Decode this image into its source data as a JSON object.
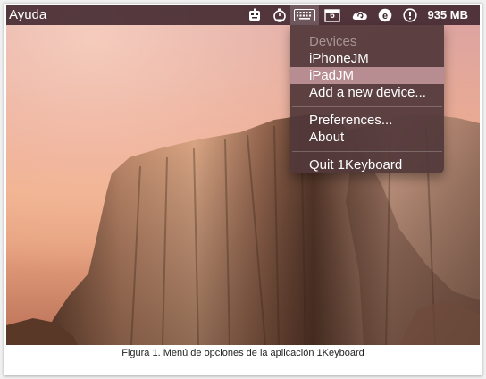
{
  "menubar": {
    "app_menu_label": "Ayuda",
    "memory_label": "935 MB",
    "calendar_day": "6",
    "status_icons": [
      "robot-icon",
      "timer-icon",
      "keyboard-icon",
      "calendar-icon",
      "cloud-sync-icon",
      "e-circle-icon",
      "info-circle-icon"
    ]
  },
  "dropdown": {
    "header": "Devices",
    "items": [
      {
        "label": "iPhoneJM"
      },
      {
        "label": "iPadJM"
      },
      {
        "label": "Add a new device..."
      },
      {
        "label": "Preferences..."
      },
      {
        "label": "About"
      },
      {
        "label": "Quit 1Keyboard"
      }
    ],
    "selected_index": 1
  },
  "caption": "Figura 1. Menú de opciones de la aplicación 1Keyboard",
  "colors": {
    "menubar_bg": "#3e242c",
    "dropdown_bg": "#52383a",
    "selection": "#b88d92"
  }
}
